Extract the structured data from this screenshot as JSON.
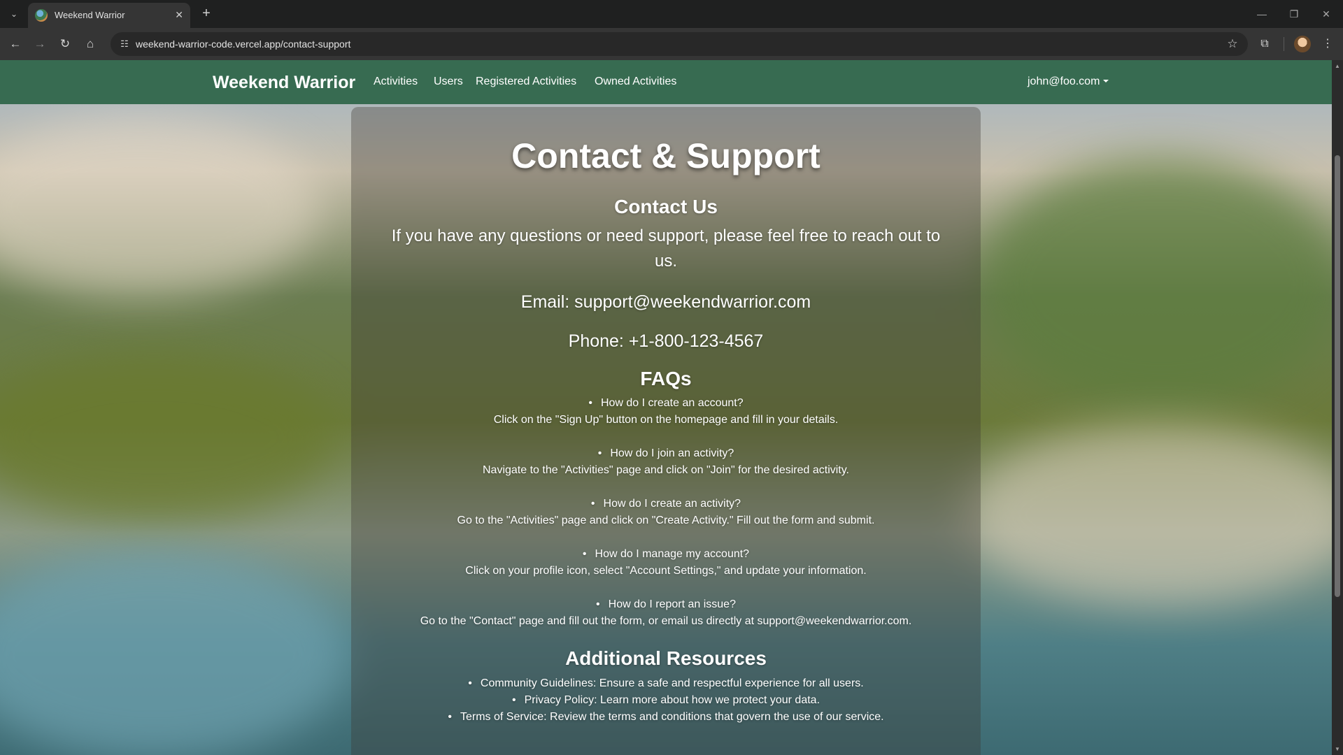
{
  "browser": {
    "tab_title": "Weekend Warrior",
    "tab_favicon": "globe-landscape-favicon",
    "url": "weekend-warrior-code.vercel.app/contact-support",
    "icons": [
      "tab-search-icon",
      "close-icon",
      "plus-icon",
      "minimize-icon",
      "restore-icon",
      "close-window-icon",
      "back-arrow-icon",
      "forward-arrow-icon",
      "reload-icon",
      "home-icon",
      "site-info-icon",
      "star-icon",
      "extensions-icon",
      "profile-avatar",
      "menu-kebab-icon"
    ]
  },
  "navbar": {
    "brand": "Weekend Warrior",
    "links": [
      "Activities",
      "Users",
      "Registered Activities",
      "Owned Activities"
    ],
    "user": "john@foo.com",
    "color": "#376b51"
  },
  "page": {
    "title": "Contact & Support",
    "contact_heading": "Contact Us",
    "intro": "If you have any questions or need support, please feel free to reach out to us.",
    "email": "Email: support@weekendwarrior.com",
    "phone": "Phone: +1-800-123-4567",
    "faq_heading": "FAQs",
    "faqs": [
      {
        "q": "How do I create an account?",
        "a": "Click on the \"Sign Up\" button on the homepage and fill in your details."
      },
      {
        "q": "How do I join an activity?",
        "a": "Navigate to the \"Activities\" page and click on \"Join\" for the desired activity."
      },
      {
        "q": "How do I create an activity?",
        "a": "Go to the \"Activities\" page and click on \"Create Activity.\" Fill out the form and submit."
      },
      {
        "q": "How do I manage my account?",
        "a": "Click on your profile icon, select \"Account Settings,\" and update your information."
      },
      {
        "q": "How do I report an issue?",
        "a": "Go to the \"Contact\" page and fill out the form, or email us directly at support@weekendwarrior.com."
      }
    ],
    "resources_heading": "Additional Resources",
    "resources": [
      "Community Guidelines: Ensure a safe and respectful experience for all users.",
      "Privacy Policy: Learn more about how we protect your data.",
      "Terms of Service: Review the terms and conditions that govern the use of our service."
    ]
  }
}
